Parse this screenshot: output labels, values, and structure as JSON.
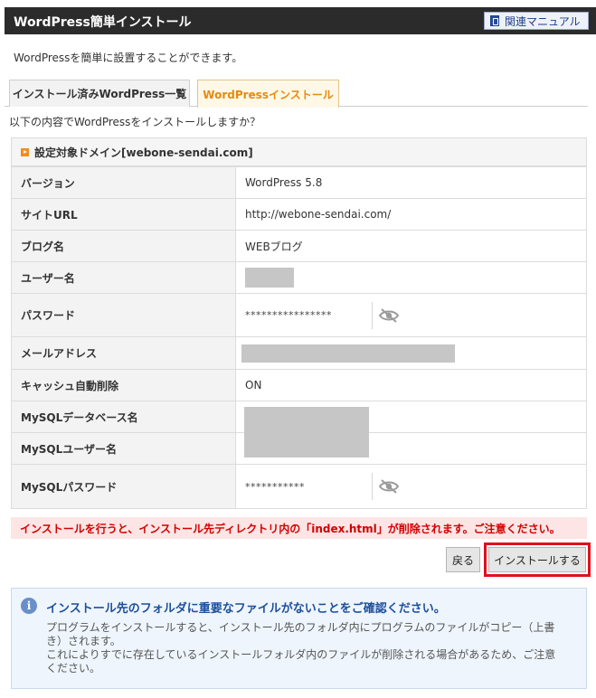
{
  "header": {
    "title": "WordPress簡単インストール",
    "manual_label": "関連マニュアル"
  },
  "intro": "WordPressを簡単に設置することができます。",
  "tabs": [
    {
      "label": "インストール済みWordPress一覧",
      "active": false
    },
    {
      "label": "WordPressインストール",
      "active": true
    }
  ],
  "question": "以下の内容でWordPressをインストールしますか？",
  "section": {
    "title": "設定対象ドメイン[webone-sendai.com]"
  },
  "fields": {
    "version": {
      "label": "バージョン",
      "value": "WordPress 5.8"
    },
    "site_url": {
      "label": "サイトURL",
      "value": "http://webone-sendai.com/"
    },
    "blog_name": {
      "label": "ブログ名",
      "value": "WEBブログ"
    },
    "username": {
      "label": "ユーザー名"
    },
    "password": {
      "label": "パスワード",
      "value": "****************"
    },
    "email": {
      "label": "メールアドレス"
    },
    "cache_delete": {
      "label": "キャッシュ自動削除",
      "value": "ON"
    },
    "mysql_db": {
      "label": "MySQLデータベース名"
    },
    "mysql_user": {
      "label": "MySQLユーザー名"
    },
    "mysql_password": {
      "label": "MySQLパスワード",
      "value": "***********"
    }
  },
  "warning": "インストールを行うと、インストール先ディレクトリ内の「index.html」が削除されます。ご注意ください。",
  "buttons": {
    "back": "戻る",
    "install": "インストールする"
  },
  "notice": {
    "title": "インストール先のフォルダに重要なファイルがないことをご確認ください。",
    "line1": "プログラムをインストールすると、インストール先のフォルダ内にプログラムのファイルがコピー（上書き）されます。",
    "line2": "これによりすでに存在しているインストールフォルダ内のファイルが削除される場合があるため、ご注意ください。"
  },
  "colors": {
    "header_bg": "#2b2b2b",
    "active_tab": "#e58a10",
    "warning_text": "#d40000",
    "highlight_frame": "#e0101d",
    "notice_title": "#1d4f9a"
  },
  "icons": [
    "book-icon",
    "bullet-icon",
    "eye-icon",
    "info-icon"
  ]
}
